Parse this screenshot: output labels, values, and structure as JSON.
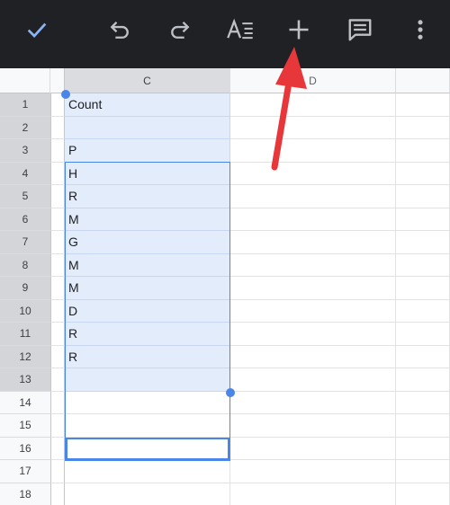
{
  "toolbar": {
    "buttons": [
      {
        "name": "done-check-icon",
        "label": "Done"
      },
      {
        "name": "undo-icon",
        "label": "Undo"
      },
      {
        "name": "redo-icon",
        "label": "Redo"
      },
      {
        "name": "text-format-icon",
        "label": "Format"
      },
      {
        "name": "insert-plus-icon",
        "label": "Insert"
      },
      {
        "name": "comment-icon",
        "label": "Comment"
      },
      {
        "name": "more-vert-icon",
        "label": "More options"
      }
    ]
  },
  "columns": [
    "C",
    "D"
  ],
  "selected_column": "C",
  "rows": [
    {
      "num": "1",
      "c": "Count"
    },
    {
      "num": "2",
      "c": ""
    },
    {
      "num": "3",
      "c": "P"
    },
    {
      "num": "4",
      "c": "H"
    },
    {
      "num": "5",
      "c": "R"
    },
    {
      "num": "6",
      "c": "M"
    },
    {
      "num": "7",
      "c": "G"
    },
    {
      "num": "8",
      "c": "M"
    },
    {
      "num": "9",
      "c": "M"
    },
    {
      "num": "10",
      "c": "D"
    },
    {
      "num": "11",
      "c": "R"
    },
    {
      "num": "12",
      "c": "R"
    },
    {
      "num": "13",
      "c": ""
    },
    {
      "num": "14",
      "c": ""
    },
    {
      "num": "15",
      "c": ""
    },
    {
      "num": "16",
      "c": ""
    },
    {
      "num": "17",
      "c": ""
    },
    {
      "num": "18",
      "c": ""
    }
  ],
  "selection": {
    "range": "C1:C13",
    "active_cell": "C13"
  },
  "colors": {
    "toolbar_bg": "#202124",
    "accent": "#4a86e8",
    "selection_fill": "#e3ecfb",
    "annotation_arrow": "#e8373b"
  }
}
